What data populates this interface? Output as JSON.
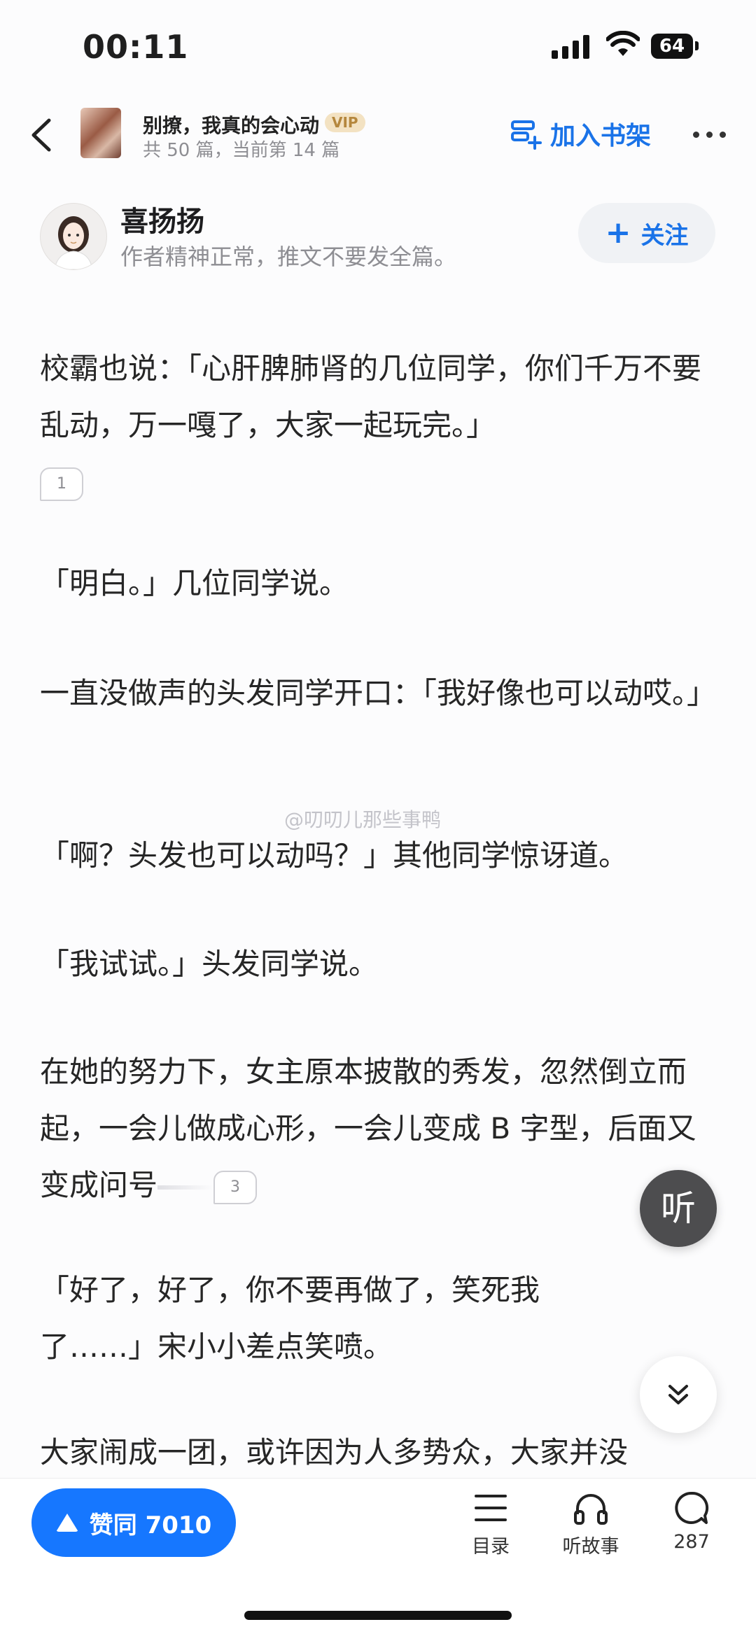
{
  "status_bar": {
    "time": "00:11",
    "battery": "64"
  },
  "header": {
    "book_title": "别撩，我真的会心动",
    "vip_badge": "VIP",
    "book_progress": "共 50 篇，当前第 14 篇",
    "add_to_shelf": "加入书架"
  },
  "author": {
    "name": "喜扬扬",
    "description": "作者精神正常，推文不要发全篇。",
    "follow_label": "关注"
  },
  "content": {
    "p1": "校霸也说：「心肝脾肺肾的几位同学，你们千万不要乱动，万一嘎了，大家一起玩完。」",
    "p1_note": "1",
    "p2": "「明白。」几位同学说。",
    "p3": "一直没做声的头发同学开口：「我好像也可以动哎。」",
    "p4": "「啊？头发也可以动吗？」其他同学惊讶道。",
    "p5": "「我试试。」头发同学说。",
    "p6": "在她的努力下，女主原本披散的秀发，忽然倒立而起，一会儿做成心形，一会儿变成 B 字型，后面又变成问号",
    "p6_note": "3",
    "p7": "「好了，好了，你不要再做了，笑死我了……」宋小小差点笑喷。",
    "p8": "大家闹成一团，或许因为人多势众，大家并没"
  },
  "watermark": "@叨叨儿那些事鸭",
  "listen_button": "听",
  "bottom_bar": {
    "like_label": "赞同 7010",
    "toc_label": "目录",
    "audio_label": "听故事",
    "comments_count": "287"
  },
  "colors": {
    "accent": "#1677ff",
    "link_blue": "#1a73e8",
    "vip_gold": "#b5873d"
  }
}
